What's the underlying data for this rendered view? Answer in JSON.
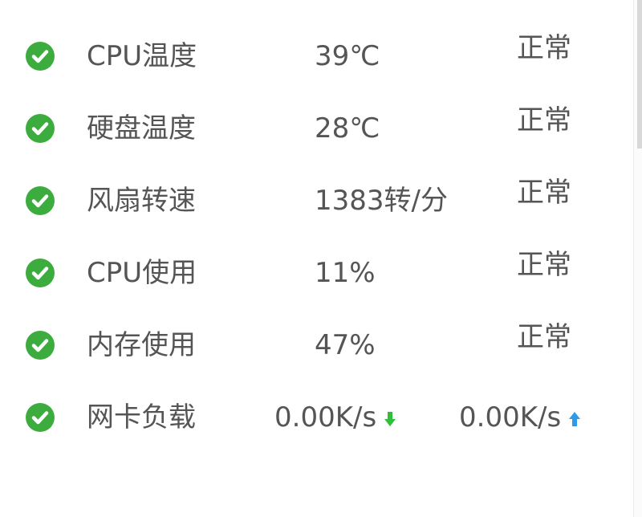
{
  "monitor": {
    "rows": [
      {
        "label": "CPU温度",
        "value": "39℃",
        "status": "正常"
      },
      {
        "label": "硬盘温度",
        "value": "28℃",
        "status": "正常"
      },
      {
        "label": "风扇转速",
        "value": "1383转/分",
        "status": "正常"
      },
      {
        "label": "CPU使用",
        "value": "11%",
        "status": "正常"
      },
      {
        "label": "内存使用",
        "value": "47%",
        "status": "正常"
      }
    ],
    "network": {
      "label": "网卡负载",
      "download": "0.00K/s",
      "upload": "0.00K/s"
    }
  },
  "icons": {
    "status_ok": "check-circle-icon",
    "download": "arrow-down-icon",
    "upload": "arrow-up-icon"
  },
  "colors": {
    "ok_green": "#3dac3f",
    "download_green": "#2fbf3a",
    "upload_blue": "#2f9ae8",
    "text": "#555555"
  }
}
